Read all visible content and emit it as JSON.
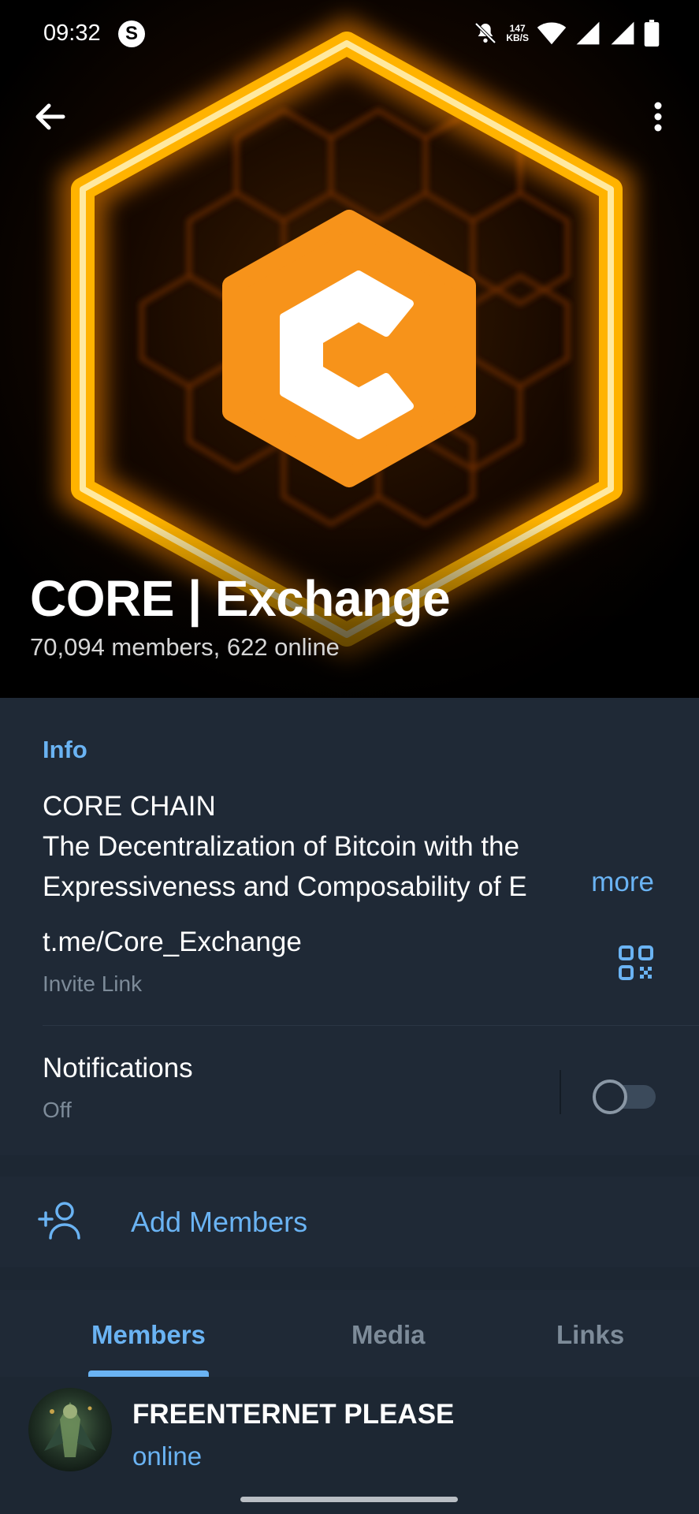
{
  "status_bar": {
    "time": "09:32",
    "app_badge": "S",
    "speed_value": "147",
    "speed_unit": "KB/S",
    "icons": [
      "mute-icon",
      "wifi-icon",
      "signal-icon",
      "signal-icon",
      "battery-icon"
    ]
  },
  "header": {
    "back_icon": "arrow-left-icon",
    "menu_icon": "more-vertical-icon",
    "title": "CORE | Exchange",
    "subtitle": "70,094 members, 622 online"
  },
  "info": {
    "section_label": "Info",
    "description_lines": [
      "CORE CHAIN",
      "The Decentralization of Bitcoin with the",
      "Expressiveness and Composability of E"
    ],
    "more_label": "more",
    "link": "t.me/Core_Exchange",
    "link_caption": "Invite Link",
    "qr_icon": "qr-code-icon",
    "notifications_label": "Notifications",
    "notifications_state": "Off"
  },
  "actions": {
    "add_members_label": "Add Members",
    "add_members_icon": "add-person-icon"
  },
  "tabs": [
    {
      "label": "Members",
      "active": true
    },
    {
      "label": "Media",
      "active": false
    },
    {
      "label": "Links",
      "active": false
    }
  ],
  "members": [
    {
      "name": "FREENTERNET PLEASE",
      "status": "online"
    }
  ],
  "colors": {
    "accent": "#6ab3f3",
    "background": "#1d2733",
    "card": "#1f2936",
    "logo_orange": "#f7931a"
  }
}
